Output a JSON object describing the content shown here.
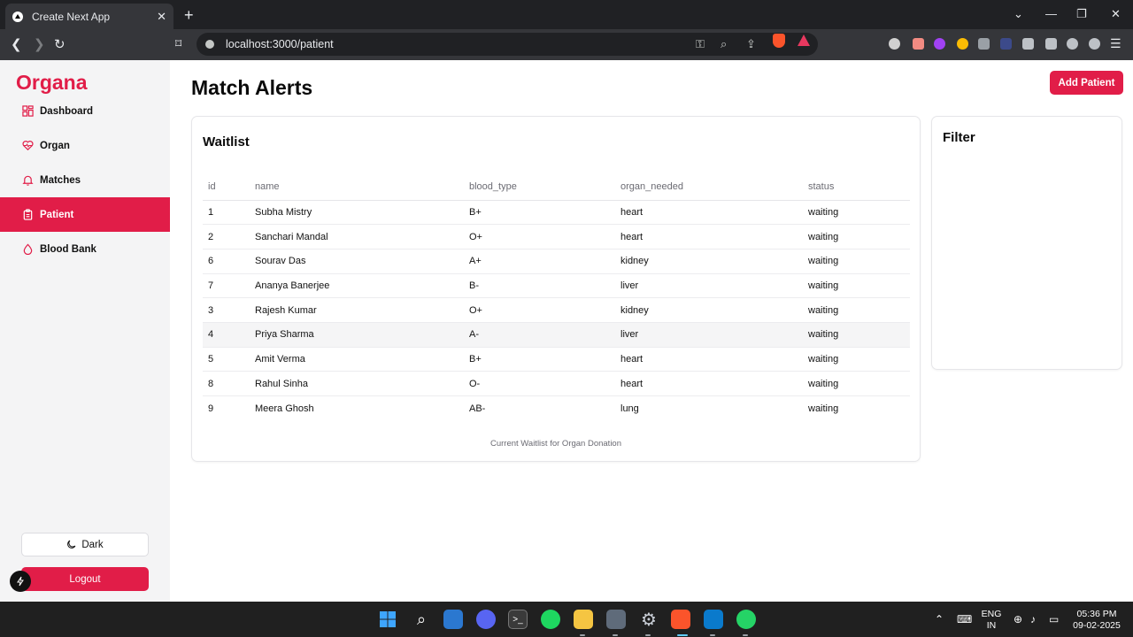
{
  "browser": {
    "tab_title": "Create Next App",
    "url": "localhost:3000/patient"
  },
  "app": {
    "brand": "Organa",
    "nav": [
      {
        "label": "Dashboard",
        "icon": "dashboard-icon",
        "active": false
      },
      {
        "label": "Organ",
        "icon": "heart-pulse-icon",
        "active": false
      },
      {
        "label": "Matches",
        "icon": "bell-icon",
        "active": false
      },
      {
        "label": "Patient",
        "icon": "clipboard-icon",
        "active": true
      },
      {
        "label": "Blood Bank",
        "icon": "droplet-icon",
        "active": false
      }
    ],
    "dark_label": "Dark",
    "logout_label": "Logout",
    "accent_color": "#e11d48"
  },
  "main": {
    "title": "Match Alerts",
    "add_button": "Add Patient",
    "waitlist": {
      "title": "Waitlist",
      "columns": [
        "id",
        "name",
        "blood_type",
        "organ_needed",
        "status"
      ],
      "rows": [
        [
          "1",
          "Subha Mistry",
          "B+",
          "heart",
          "waiting"
        ],
        [
          "2",
          "Sanchari Mandal",
          "O+",
          "heart",
          "waiting"
        ],
        [
          "6",
          "Sourav Das",
          "A+",
          "kidney",
          "waiting"
        ],
        [
          "7",
          "Ananya Banerjee",
          "B-",
          "liver",
          "waiting"
        ],
        [
          "3",
          "Rajesh Kumar",
          "O+",
          "kidney",
          "waiting"
        ],
        [
          "4",
          "Priya Sharma",
          "A-",
          "liver",
          "waiting"
        ],
        [
          "5",
          "Amit Verma",
          "B+",
          "heart",
          "waiting"
        ],
        [
          "8",
          "Rahul Sinha",
          "O-",
          "heart",
          "waiting"
        ],
        [
          "9",
          "Meera Ghosh",
          "AB-",
          "lung",
          "waiting"
        ]
      ],
      "caption": "Current Waitlist for Organ Donation"
    },
    "filter_title": "Filter"
  },
  "taskbar": {
    "lang_top": "ENG",
    "lang_bottom": "IN",
    "time": "05:36 PM",
    "date": "09-02-2025"
  }
}
